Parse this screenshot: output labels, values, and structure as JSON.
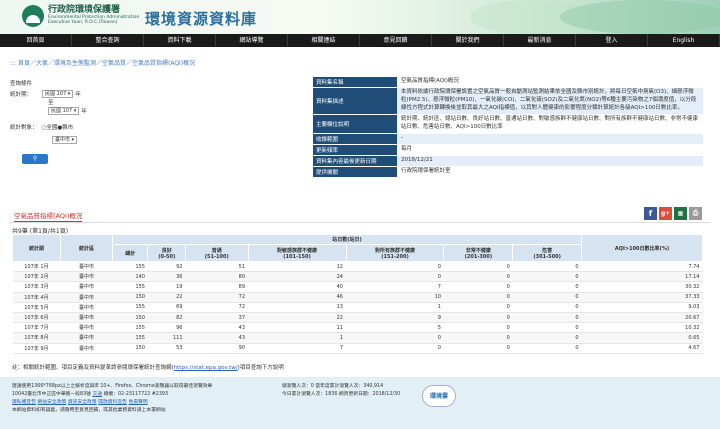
{
  "header": {
    "agency_cn": "行政院環境保護署",
    "agency_en1": "Environmental Protection Administration",
    "agency_en2": "Executive Yuan, R.O.C.(Taiwan)",
    "site_title": "環境資源資料庫"
  },
  "nav": [
    "回首頁",
    "整合查詢",
    "資料下載",
    "網站導覽",
    "相關連結",
    "意見回饋",
    "關於我們",
    "最新消息",
    "登入",
    "English"
  ],
  "breadcrumb": "::: 首頁／大氣／環境及生態監測／空氣品質／空氣品質指標(AQI)概況",
  "query": {
    "title": "查詢條件",
    "stat_period_label": "統計期：",
    "year_from": "民國 107 ▾",
    "year_unit": "年",
    "to": "至",
    "year_to": "民國 107 ▾",
    "target_label": "統計對象：",
    "opt1": "○全國",
    "opt2": "●縣市",
    "county": "臺中市 ▾",
    "search_icon": "search-icon"
  },
  "meta": [
    {
      "k": "資料集名稱",
      "v": "空氣品質指標(AQI)概況"
    },
    {
      "k": "資料集描述",
      "v": "本資料依據行政院環保署設置之空氣品質一般自動測站監測結果依全國及縣市別統計，將每日空氣中臭氧(O3)、細懸浮微粒(PM2.5)、懸浮微粒(PM10)、一氧化碳(CO)、二氧化硫(SO2)及二氧化氮(NO2)等6種主要污染物之7個濃度值，以分段線性方程式計算轉換後並取其最大之AQI指標值，以其對人體健康的影響程度分類計算統計各級AQI>100日數比率。"
    },
    {
      "k": "主要欄位說明",
      "v": "統計期、統計區、總站日數、良好站日數、普通站日數、對敏感族群不健康站日數、對所有族群不健康站日數、非常不健康站日數、危害站日數、AQI>100日數比率"
    },
    {
      "k": "收錄範圍",
      "v": "-"
    },
    {
      "k": "更新頻率",
      "v": "每月"
    },
    {
      "k": "資料集內容最後更新日期",
      "v": "2018/12/21"
    },
    {
      "k": "提供機關",
      "v": "行政院環保署統計室"
    }
  ],
  "tab_label": "空氣品質指標(AQI)概況",
  "count_text": "共9筆 (第1頁/共1頁)",
  "share_icons": [
    "facebook-icon",
    "google-plus-icon",
    "excel-icon",
    "print-icon"
  ],
  "table": {
    "h_period": "統計期",
    "h_area": "統計區",
    "h_group": "站日數(站日)",
    "h_total": "總計",
    "h_good": "良好\n(0-50)",
    "h_moderate": "普通\n(51-100)",
    "h_sensitive": "對敏感族群不健康\n(101-150)",
    "h_unhealthy": "對所有族群不健康\n(151-200)",
    "h_very": "非常不健康\n(201-300)",
    "h_hazard": "危害\n(301-500)",
    "h_ratio": "AQI>100日數比率(%)",
    "rows": [
      [
        "107年 1月",
        "臺中市",
        "155",
        "92",
        "51",
        "12",
        "0",
        "0",
        "0",
        "7.74"
      ],
      [
        "107年 2月",
        "臺中市",
        "140",
        "36",
        "80",
        "24",
        "0",
        "0",
        "0",
        "17.14"
      ],
      [
        "107年 3月",
        "臺中市",
        "155",
        "19",
        "89",
        "40",
        "7",
        "0",
        "0",
        "30.32"
      ],
      [
        "107年 4月",
        "臺中市",
        "150",
        "22",
        "72",
        "46",
        "10",
        "0",
        "0",
        "37.33"
      ],
      [
        "107年 5月",
        "臺中市",
        "155",
        "69",
        "72",
        "13",
        "1",
        "0",
        "0",
        "9.03"
      ],
      [
        "107年 6月",
        "臺中市",
        "150",
        "82",
        "37",
        "22",
        "9",
        "0",
        "0",
        "20.67"
      ],
      [
        "107年 7月",
        "臺中市",
        "155",
        "96",
        "43",
        "11",
        "5",
        "0",
        "0",
        "10.32"
      ],
      [
        "107年 8月",
        "臺中市",
        "155",
        "111",
        "43",
        "1",
        "0",
        "0",
        "0",
        "0.65"
      ],
      [
        "107年 9月",
        "臺中市",
        "150",
        "53",
        "90",
        "7",
        "0",
        "0",
        "0",
        "4.67"
      ]
    ]
  },
  "note_prefix": "註：相關統計範圍、項目定義及資料變革請參閱環保署統計查詢網(",
  "note_link": "https://stat.epa.gov.tw/",
  "note_suffix": ")項目查詢下方說明",
  "footer": {
    "line1": "建議使用1366*768px以上之解析度與IE 10+、Firefox、Chrome瀏覽器以取得最佳瀏覽效果",
    "line2a": "10042臺北市中正區中華路一段83號",
    "line2b": "交通",
    "line2c": "總機：02-23117722 #2393",
    "link1": "隱私權宣告",
    "link2": "網站安全政策",
    "link3": "資訊安全政策",
    "link4": "開放資料宣告",
    "link5": "免責聲明",
    "line3": "本網站資料如有疑義，請隨時至意見回饋，或其他業務資料請上本署網站",
    "visit1": "總瀏覽人次：0  當年度累計瀏覽人次：340,914",
    "visit2": "今日累計瀏覽人次：1836  網頁更新日期：2018/12/30",
    "cloud_label": "環境雲"
  }
}
